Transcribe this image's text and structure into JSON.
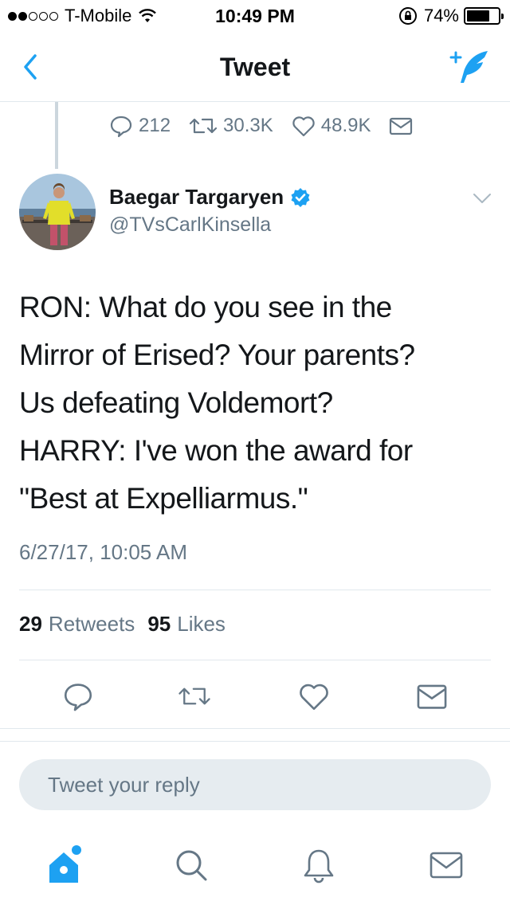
{
  "status_bar": {
    "carrier": "T-Mobile",
    "time": "10:49 PM",
    "battery": "74%",
    "signal_full": 2,
    "signal_total": 5,
    "battery_level": 0.74
  },
  "nav": {
    "title": "Tweet",
    "back_icon": "chevron-left-icon",
    "compose_icon": "compose-tweet-icon"
  },
  "parent_tweet_actions": {
    "replies": "212",
    "retweets": "30.3K",
    "likes": "48.9K"
  },
  "author": {
    "name": "Baegar Targaryen",
    "handle": "@TVsCarlKinsella",
    "verified": true
  },
  "tweet": {
    "lines": [
      "RON: What do you see in the",
      "Mirror of Erised? Your parents?",
      "Us defeating Voldemort?",
      "HARRY: I've won the award for",
      "\"Best at Expelliarmus.\""
    ],
    "timestamp": "6/27/17, 10:05 AM"
  },
  "stats": {
    "retweets_count": "29",
    "retweets_label": "Retweets",
    "likes_count": "95",
    "likes_label": "Likes"
  },
  "reply": {
    "placeholder": "Tweet your reply"
  },
  "colors": {
    "accent": "#1da1f2",
    "text": "#14171a",
    "secondary": "#657786",
    "border": "#e1e8ed"
  }
}
